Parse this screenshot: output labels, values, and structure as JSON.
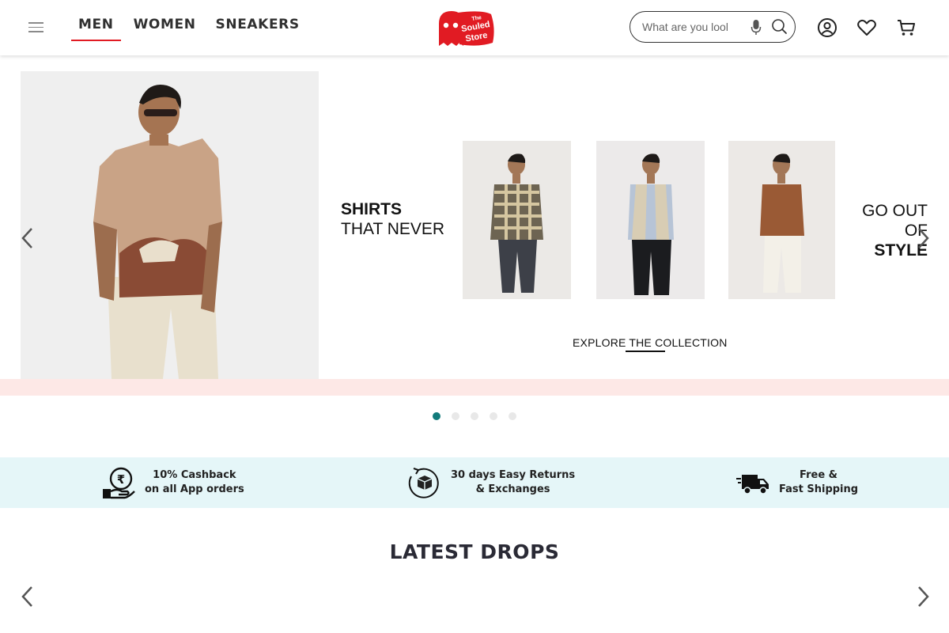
{
  "header": {
    "nav_tabs": [
      {
        "label": "MEN",
        "active": true
      },
      {
        "label": "WOMEN",
        "active": false
      },
      {
        "label": "SNEAKERS",
        "active": false
      }
    ],
    "logo_text_line1": "The",
    "logo_text_line2": "Souled",
    "logo_text_line3": "Store",
    "search_placeholder": "What are you looking for?",
    "accent_color": "#e11b23",
    "icons": [
      "menu-icon",
      "mic-icon",
      "search-icon",
      "account-icon",
      "wishlist-icon",
      "cart-icon"
    ]
  },
  "hero": {
    "banner_line1": "SHIRTS",
    "banner_line2": "THAT NEVER",
    "banner_line3": "GO OUT",
    "banner_line4_prefix": "OF ",
    "banner_line4_bold": "STYLE",
    "explore_label": "EXPLORE THE COLLECTION",
    "band_color": "#fde8e6",
    "slides_total": 5,
    "active_slide": 1,
    "active_dot_color": "#117a7a"
  },
  "benefits": [
    {
      "line1": "10% Cashback",
      "line2": "on all App orders",
      "icon": "cashback-icon"
    },
    {
      "line1": "30 days Easy Returns",
      "line2": "& Exchanges",
      "icon": "returns-icon"
    },
    {
      "line1": "Free &",
      "line2": "Fast Shipping",
      "icon": "shipping-truck-icon"
    }
  ],
  "sections": {
    "latest_drops_title": "LATEST DROPS"
  }
}
